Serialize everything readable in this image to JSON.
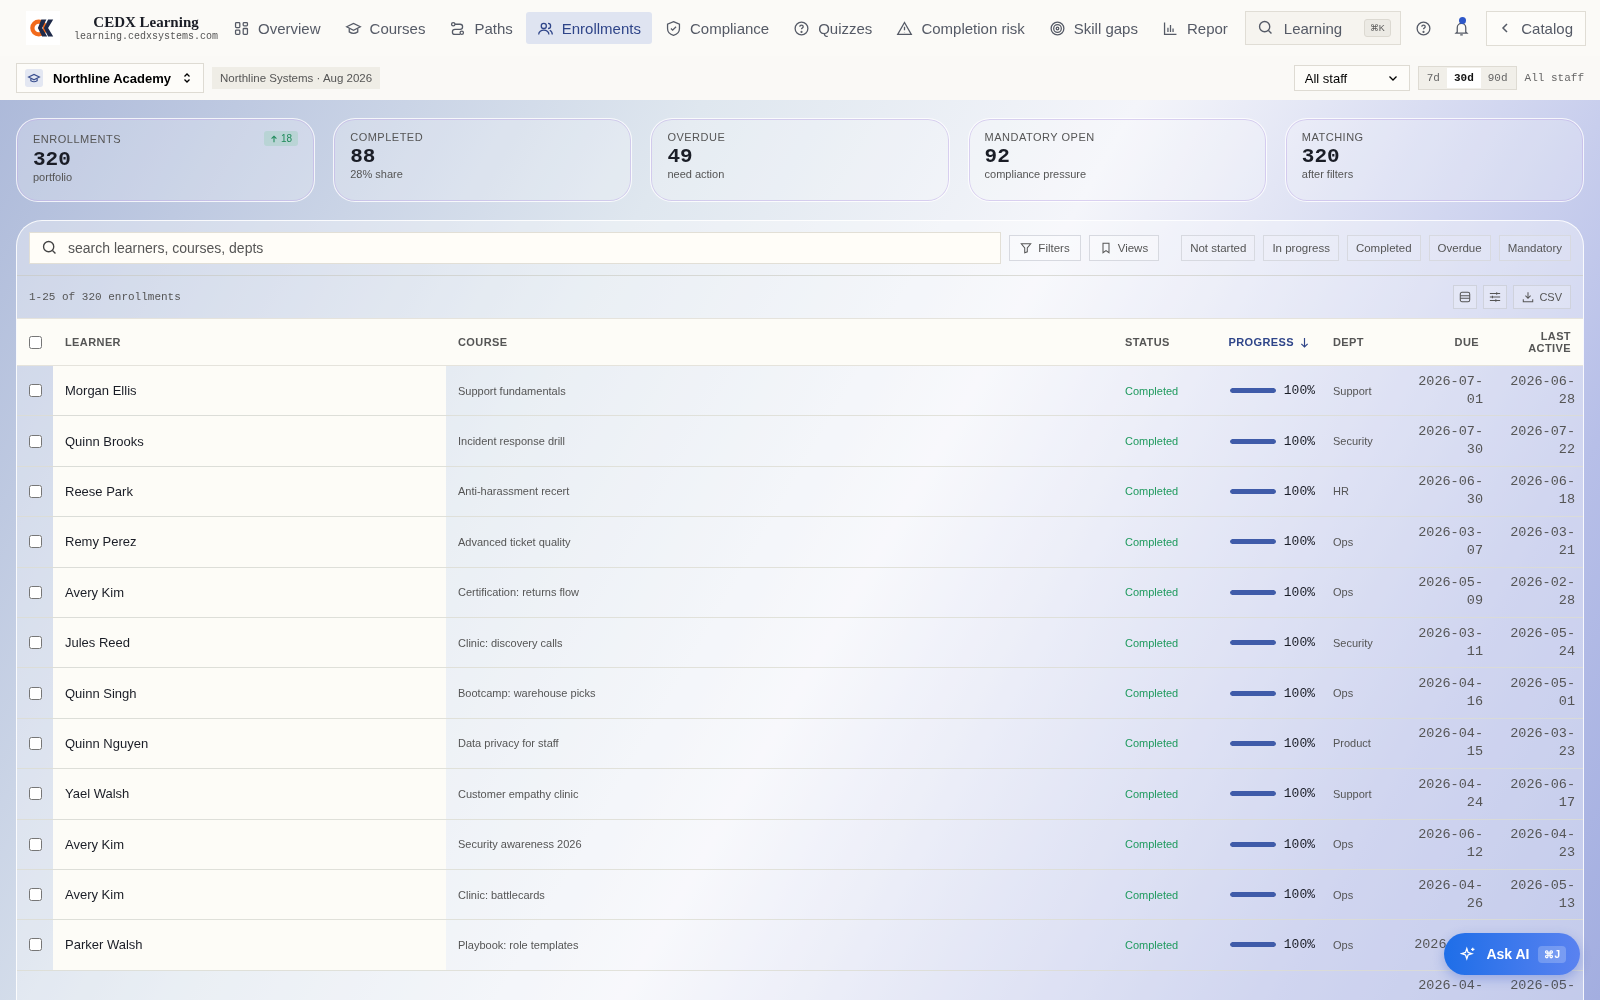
{
  "brand": {
    "name": "CEDX Learning",
    "domain": "learning.cedxsystems.com"
  },
  "nav": [
    {
      "label": "Overview",
      "selected": false
    },
    {
      "label": "Courses",
      "selected": false
    },
    {
      "label": "Paths",
      "selected": false
    },
    {
      "label": "Enrollments",
      "selected": true
    },
    {
      "label": "Compliance",
      "selected": false
    },
    {
      "label": "Quizzes",
      "selected": false
    },
    {
      "label": "Completion risk",
      "selected": false
    },
    {
      "label": "Skill gaps",
      "selected": false
    },
    {
      "label": "Repor",
      "selected": false
    }
  ],
  "search": {
    "placeholder": "Learning",
    "shortcut": "⌘K"
  },
  "notifications": {
    "unread": true
  },
  "catalog_button": "Catalog",
  "workspace": {
    "name": "Northline Academy",
    "context": "Northline Systems · Aug 2026"
  },
  "audience_select": "All staff",
  "ranges": [
    {
      "label": "7d",
      "selected": false
    },
    {
      "label": "30d",
      "selected": true
    },
    {
      "label": "90d",
      "selected": false
    }
  ],
  "audience_label": "All staff",
  "stats": [
    {
      "label": "ENROLLMENTS",
      "value": "320",
      "sub": "portfolio",
      "delta": "18"
    },
    {
      "label": "COMPLETED",
      "value": "88",
      "sub": "28% share"
    },
    {
      "label": "OVERDUE",
      "value": "49",
      "sub": "need action"
    },
    {
      "label": "MANDATORY OPEN",
      "value": "92",
      "sub": "compliance pressure"
    },
    {
      "label": "MATCHING",
      "value": "320",
      "sub": "after filters"
    }
  ],
  "table_search": {
    "placeholder": "search learners, courses, depts"
  },
  "filters_button": "Filters",
  "views_button": "Views",
  "chips": [
    "Not started",
    "In progress",
    "Completed",
    "Overdue",
    "Mandatory"
  ],
  "count": "1-25 of 320 enrollments",
  "csv_button": "CSV",
  "select_all": {
    "checked": false
  },
  "columns": [
    {
      "label": "LEARNER",
      "sorted": false
    },
    {
      "label": "COURSE",
      "sorted": false
    },
    {
      "label": "STATUS",
      "sorted": false
    },
    {
      "label": "PROGRESS",
      "sorted": true
    },
    {
      "label": "DEPT",
      "sorted": false
    },
    {
      "label": "DUE",
      "sorted": false
    },
    {
      "label": "LAST ACTIVE",
      "sorted": false
    }
  ],
  "rows": [
    {
      "checked": false,
      "learner": "Morgan Ellis",
      "course": "Support fundamentals",
      "status": "Completed",
      "kind": "completed",
      "level": 1,
      "progress": "100%",
      "dept": "Support",
      "due": "2026-07-01",
      "last_active": "2026-06-28"
    },
    {
      "checked": false,
      "learner": "Quinn Brooks",
      "course": "Incident response drill",
      "status": "Completed",
      "kind": "completed",
      "level": 1,
      "progress": "100%",
      "dept": "Security",
      "due": "2026-07-30",
      "last_active": "2026-07-22"
    },
    {
      "checked": false,
      "learner": "Reese Park",
      "course": "Anti-harassment recert",
      "status": "Completed",
      "kind": "completed",
      "level": 1,
      "progress": "100%",
      "dept": "HR",
      "due": "2026-06-30",
      "last_active": "2026-06-18"
    },
    {
      "checked": false,
      "learner": "Remy Perez",
      "course": "Advanced ticket quality",
      "status": "Completed",
      "kind": "completed",
      "level": 1,
      "progress": "100%",
      "dept": "Ops",
      "due": "2026-03-07",
      "last_active": "2026-03-21"
    },
    {
      "checked": false,
      "learner": "Avery Kim",
      "course": "Certification: returns flow",
      "status": "Completed",
      "kind": "completed",
      "level": 1,
      "progress": "100%",
      "dept": "Ops",
      "due": "2026-05-09",
      "last_active": "2026-02-28"
    },
    {
      "checked": false,
      "learner": "Jules Reed",
      "course": "Clinic: discovery calls",
      "status": "Completed",
      "kind": "completed",
      "level": 1,
      "progress": "100%",
      "dept": "Security",
      "due": "2026-03-11",
      "last_active": "2026-05-24"
    },
    {
      "checked": false,
      "learner": "Quinn Singh",
      "course": "Bootcamp: warehouse picks",
      "status": "Completed",
      "kind": "completed",
      "level": 1,
      "progress": "100%",
      "dept": "Ops",
      "due": "2026-04-16",
      "last_active": "2026-05-01"
    },
    {
      "checked": false,
      "learner": "Quinn Nguyen",
      "course": "Data privacy for staff",
      "status": "Completed",
      "kind": "completed",
      "level": 1,
      "progress": "100%",
      "dept": "Product",
      "due": "2026-04-15",
      "last_active": "2026-03-23"
    },
    {
      "checked": false,
      "learner": "Yael Walsh",
      "course": "Customer empathy clinic",
      "status": "Completed",
      "kind": "completed",
      "level": 1,
      "progress": "100%",
      "dept": "Support",
      "due": "2026-04-24",
      "last_active": "2026-06-17"
    },
    {
      "checked": false,
      "learner": "Avery Kim",
      "course": "Security awareness 2026",
      "status": "Completed",
      "kind": "completed",
      "level": 1,
      "progress": "100%",
      "dept": "Ops",
      "due": "2026-06-12",
      "last_active": "2026-04-23"
    },
    {
      "checked": false,
      "learner": "Avery Kim",
      "course": "Clinic: battlecards",
      "status": "Completed",
      "kind": "completed",
      "level": 1,
      "progress": "100%",
      "dept": "Ops",
      "due": "2026-04-26",
      "last_active": "2026-05-13"
    },
    {
      "checked": false,
      "learner": "Parker Walsh",
      "course": "Playbook: role templates",
      "status": "Completed",
      "kind": "completed",
      "level": 1,
      "progress": "100%",
      "dept": "Ops",
      "due": "2026"
    },
    {
      "due": "2026-04-",
      "last_active": "2026-05-"
    }
  ],
  "ask_ai": {
    "label": "Ask AI",
    "shortcut": "⌘J"
  }
}
